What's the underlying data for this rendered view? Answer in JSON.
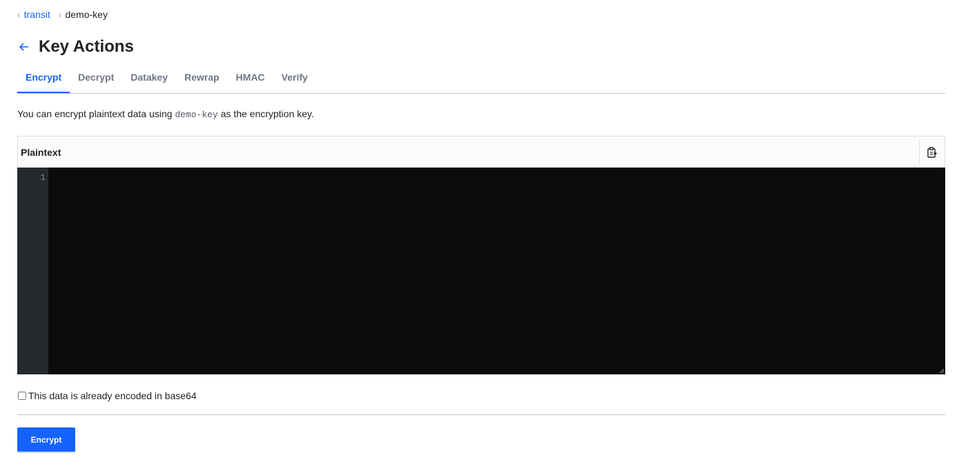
{
  "breadcrumb": [
    {
      "label": "transit",
      "link": true
    },
    {
      "label": "demo-key",
      "link": false
    }
  ],
  "page_title": "Key Actions",
  "tabs": [
    {
      "label": "Encrypt",
      "active": true
    },
    {
      "label": "Decrypt",
      "active": false
    },
    {
      "label": "Datakey",
      "active": false
    },
    {
      "label": "Rewrap",
      "active": false
    },
    {
      "label": "HMAC",
      "active": false
    },
    {
      "label": "Verify",
      "active": false
    }
  ],
  "description": {
    "before": "You can encrypt plaintext data using ",
    "key_name": "demo-key",
    "after": " as the encryption key."
  },
  "editor": {
    "label": "Plaintext",
    "line_number": "1",
    "value": ""
  },
  "base64_checkbox": {
    "label": "This data is already encoded in base64",
    "checked": false
  },
  "submit_label": "Encrypt",
  "colors": {
    "accent": "#1563ff",
    "editor_bg": "#0b0b0b",
    "gutter_bg": "#25292e"
  },
  "icons": {
    "back": "arrow-left-icon",
    "copy": "clipboard-copy-icon",
    "crumb_separator": "chevron-left-icon"
  }
}
